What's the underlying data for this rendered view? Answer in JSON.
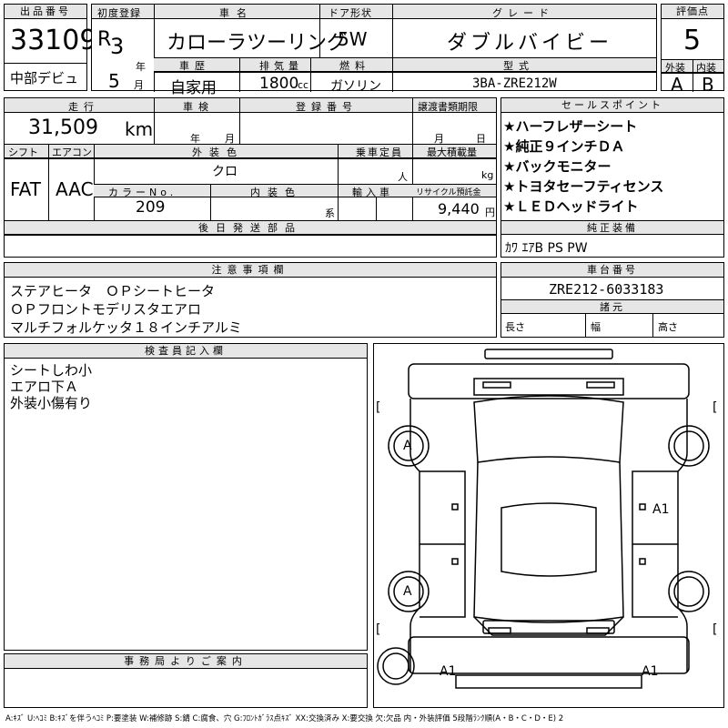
{
  "top": {
    "h_lot": "出品番号",
    "lot": "33109",
    "dealer": "中部デビュ",
    "h_first_reg": "初度登録",
    "era": "R",
    "year": "3",
    "year_unit": "年",
    "month": "5",
    "month_unit": "月",
    "h_name": "車名",
    "name": "カローラツーリング",
    "h_door": "ドア形状",
    "door": "5W",
    "h_grade": "グレード",
    "grade": "ダブルバイビー",
    "h_score": "評価点",
    "score": "5",
    "h_history": "車歴",
    "history": "自家用",
    "h_cc": "排気量",
    "cc": "1800",
    "cc_unit": "cc",
    "h_fuel": "燃料",
    "fuel": "ガソリン",
    "h_model": "型式",
    "model": "3BA-ZRE212W",
    "h_ext": "外装",
    "ext": "A",
    "h_int": "内装",
    "int": "B"
  },
  "mid": {
    "h_mileage": "走行",
    "mileage": "31,509",
    "mileage_unit": "km",
    "h_inspection": "車検",
    "insp_year": "年",
    "insp_month": "月",
    "h_regno": "登録番号",
    "h_docs": "譲渡書類期限",
    "docs_month": "月",
    "docs_day": "日",
    "h_shift": "シフト",
    "shift": "FAT",
    "h_ac": "エアコン",
    "ac": "AAC",
    "h_color": "外装色",
    "color": "クロ",
    "h_capacity": "乗車定員",
    "capacity_unit": "人",
    "h_load": "最大積載量",
    "load_unit": "kg",
    "h_colorno": "カラーNo.",
    "colorno": "209",
    "h_intcolor": "内装色",
    "intcolor_unit": "系",
    "h_import": "輸入車",
    "h_recycle": "リサイクル預託金",
    "recycle": "9,440",
    "recycle_unit": "円",
    "h_later": "後日発送部品"
  },
  "sales": {
    "h": "セールスポイント",
    "items": [
      "★ハーフレザーシート",
      "★純正９インチＤＡ",
      "★バックモニター",
      "★トヨタセーフティセンス",
      "★ＬＥＤヘッドライト"
    ],
    "h_equip": "純正装備",
    "equip": "ｶﾜ ｴｱB PS PW"
  },
  "notes": {
    "h": "注意事項欄",
    "lines": [
      "ステアヒータ　ＯＰシートヒータ",
      "ＯＰフロントモデリスタエアロ",
      "マルチフォルケッタ１８インチアルミ"
    ]
  },
  "chassis": {
    "h": "車台番号",
    "value": "ZRE212-6033183",
    "h_dims": "諸元",
    "length": "長さ",
    "width": "幅",
    "height": "高さ"
  },
  "inspector": {
    "h": "検査員記入欄",
    "lines": [
      "シートしわ小",
      "エアロ下Ａ",
      "外装小傷有り"
    ]
  },
  "office": {
    "h": "事務局よりご案内"
  },
  "diagram": {
    "tire_fl": "A",
    "tire_rl": "A",
    "side_r": "A1",
    "bumper_rl": "A1",
    "bumper_rr": "A1",
    "bracket": "["
  },
  "footer": "A:ｷｽﾞ U:ﾍｺﾐ B:ｷｽﾞを伴うﾍｺﾐ P:要塗装 W:補修跡 S:錆 C:腐食、穴 G:ﾌﾛﾝﾄｶﾞﾗｽ点ｷｽﾞ XX:交換済み X:要交換 欠:欠品 内・外装評価 5段階ﾗﾝｸ順(A・B・C・D・E) 2"
}
